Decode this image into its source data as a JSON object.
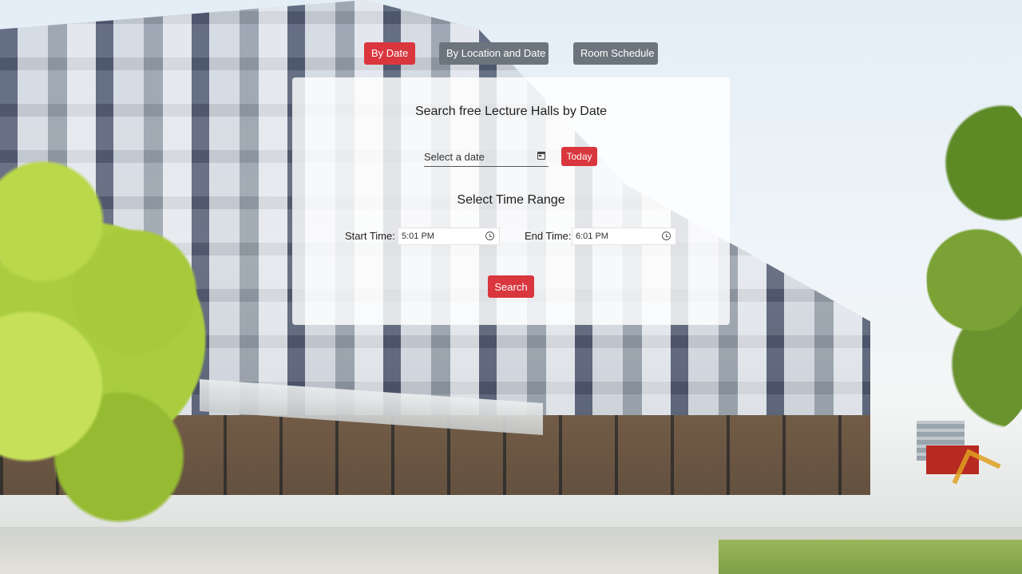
{
  "nav": {
    "by_date_label": "By Date",
    "by_location_label": "By Location and Date",
    "room_schedule_label": "Room Schedule",
    "active": "By Date"
  },
  "card": {
    "title": "Search free Lecture Halls by Date",
    "date_input": {
      "placeholder": "Select a date",
      "value": ""
    },
    "today_label": "Today",
    "time_section_title": "Select Time Range",
    "start_label": "Start Time:",
    "start_value": "5:01 PM",
    "end_label": "End Time:",
    "end_value": "6:01 PM",
    "search_label": "Search"
  },
  "colors": {
    "accent": "#d9363e",
    "secondary": "#6c757d",
    "card_background": "rgba(255,255,255,0.82)"
  },
  "icons": {
    "date": "calendar-icon",
    "time": "clock-icon"
  }
}
